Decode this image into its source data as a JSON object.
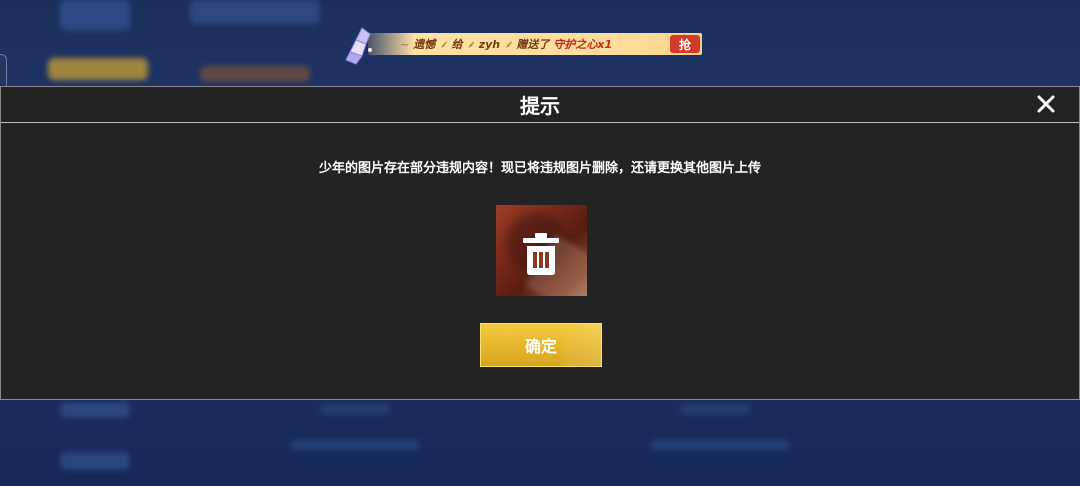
{
  "gift_banner": {
    "prefix": "遗憾",
    "to_word": "给",
    "recipient": "zyh",
    "action": "赠送了",
    "item": "守护之心x1",
    "grab_label": "抢"
  },
  "dialog": {
    "title": "提示",
    "message": "少年的图片存在部分违规内容！现已将违规图片删除，还请更换其他图片上传",
    "confirm_label": "确定"
  },
  "colors": {
    "dialog_bg": "#232323",
    "confirm_button": "#e6b52c",
    "banner_bg": "#ffe2a6",
    "grab_button": "#d43a2a"
  },
  "icons": {
    "close": "close-icon",
    "trash": "trash-icon",
    "gem": "crystal-gem-icon"
  }
}
